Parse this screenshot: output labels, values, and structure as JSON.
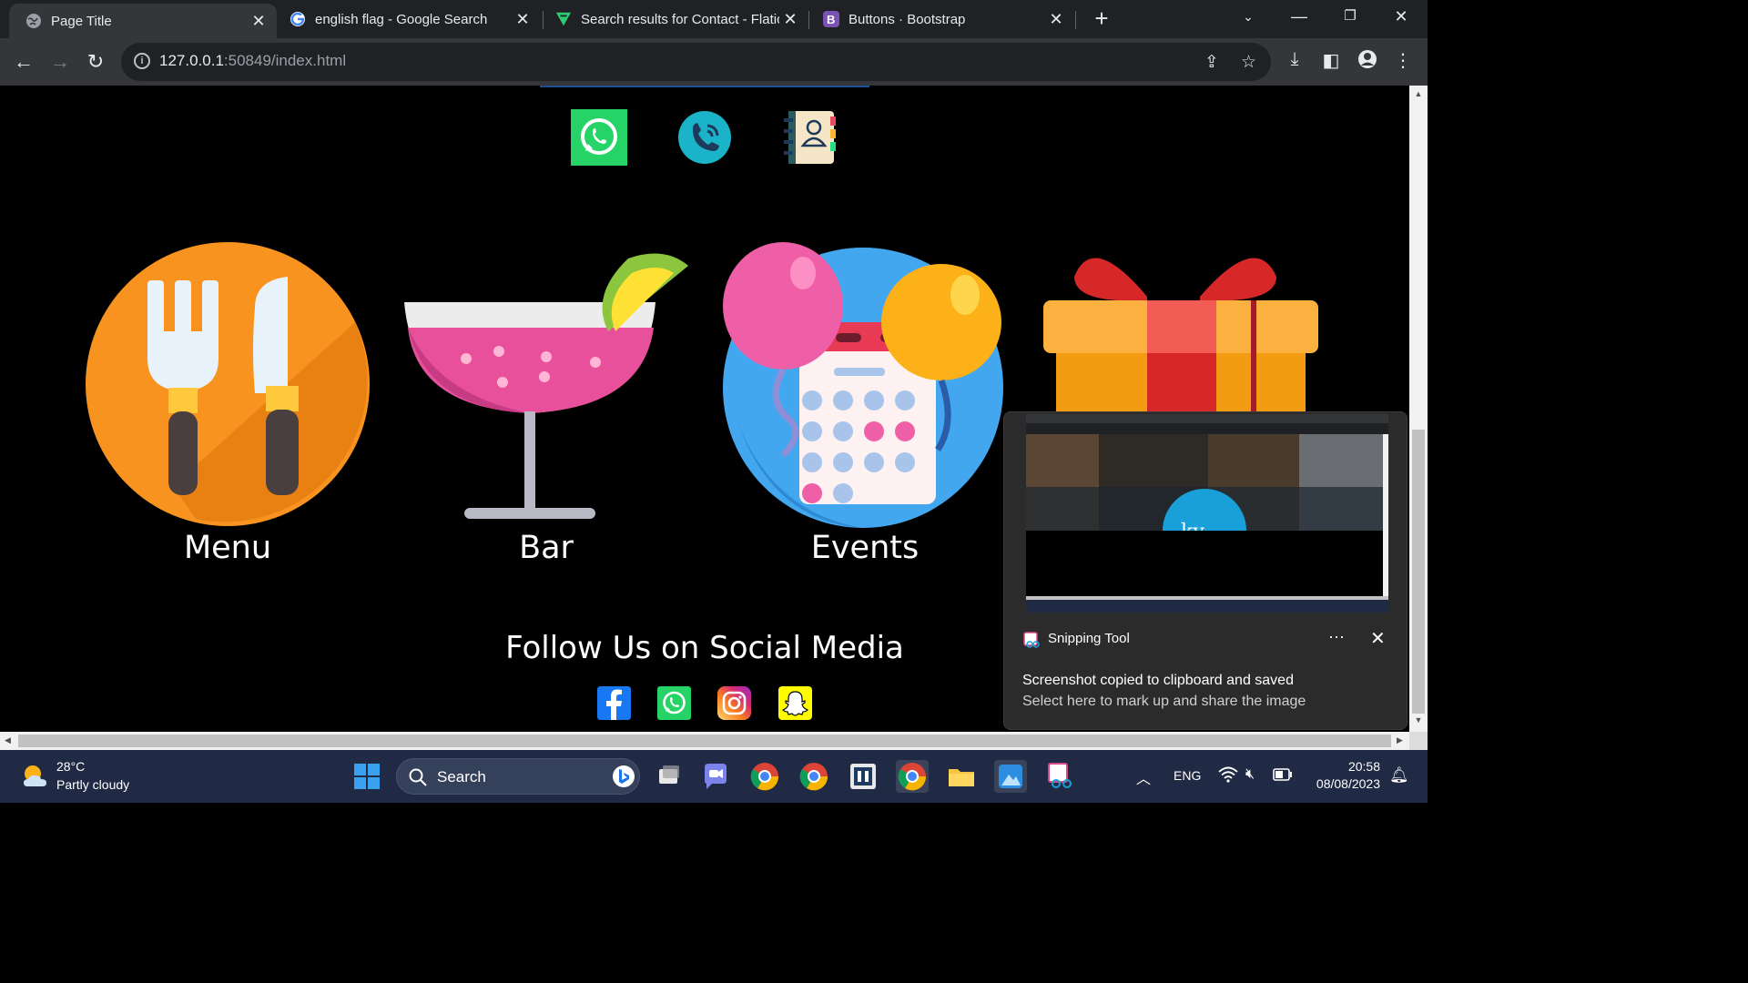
{
  "browser": {
    "tabs": [
      {
        "title": "Page Title",
        "active": true
      },
      {
        "title": "english flag - Google Search",
        "active": false
      },
      {
        "title": "Search results for Contact - Flatic",
        "active": false
      },
      {
        "title": "Buttons · Bootstrap",
        "active": false
      }
    ],
    "url_host": "127.0.0.1",
    "url_rest": ":50849/index.html"
  },
  "page": {
    "features": [
      {
        "label": "Menu"
      },
      {
        "label": "Bar"
      },
      {
        "label": "Events"
      }
    ],
    "follow_title": "Follow Us on Social Media"
  },
  "toast": {
    "app_name": "Snipping Tool",
    "title": "Screenshot copied to clipboard and saved",
    "subtitle": "Select here to mark up and share the image"
  },
  "taskbar": {
    "temperature": "28°C",
    "condition": "Partly cloudy",
    "search_label": "Search",
    "language": "ENG",
    "time": "20:58",
    "date": "08/08/2023"
  },
  "colors": {
    "page_bg": "#000000",
    "whatsapp": "#25d366",
    "facebook": "#1877f2",
    "snapchat": "#fffc00"
  }
}
